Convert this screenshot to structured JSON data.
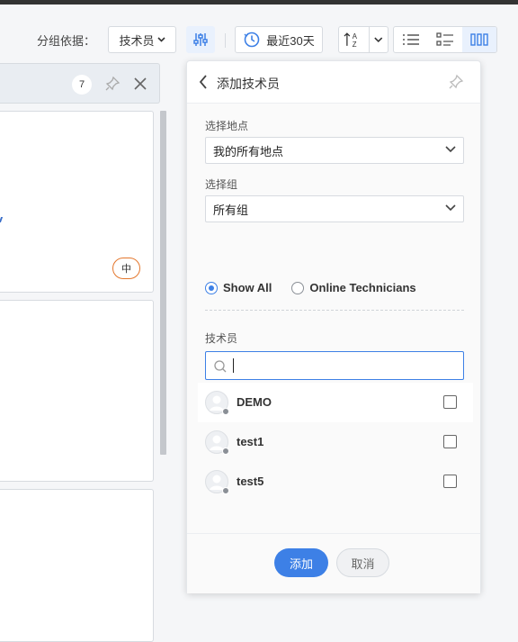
{
  "toolbar": {
    "group_by_label": "分组依据：",
    "group_by_value": "技术员",
    "date_range_label": "最近30天",
    "sort_icon_text": "A Z"
  },
  "board": {
    "column_count": "7",
    "priority_badge": "中"
  },
  "panel": {
    "title": "添加技术员",
    "site_label": "选择地点",
    "site_value": "我的所有地点",
    "group_label": "选择组",
    "group_value": "所有组",
    "radio_show_all": "Show All",
    "radio_online": "Online Technicians",
    "radio_selected": "Show All",
    "technicians_label": "技术员",
    "search_placeholder": "",
    "technicians": [
      {
        "name": "DEMO",
        "checked": false
      },
      {
        "name": "test1",
        "checked": false
      },
      {
        "name": "test5",
        "checked": false
      }
    ],
    "add_button": "添加",
    "cancel_button": "取消"
  },
  "colors": {
    "accent": "#3d80e6",
    "priority_medium": "#e4772d"
  }
}
